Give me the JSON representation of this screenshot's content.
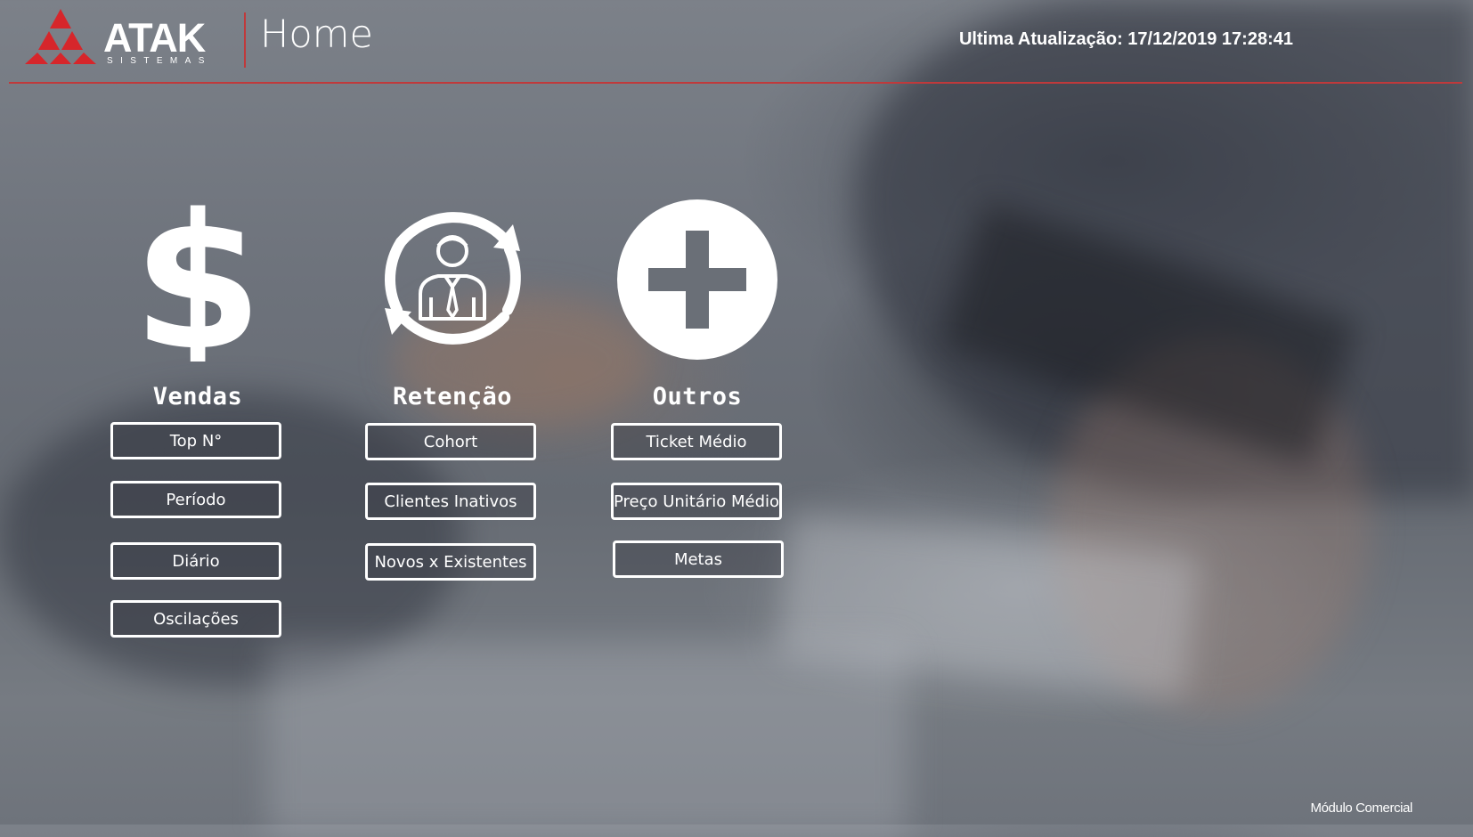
{
  "header": {
    "logo_text": "ATAK",
    "logo_subtext": "SISTEMAS",
    "page_title": "Home",
    "last_update": "Ultima Atualização: 17/12/2019 17:28:41"
  },
  "colors": {
    "accent": "#c0393b",
    "text": "#ffffff"
  },
  "sections": [
    {
      "title": "Vendas",
      "icon": "dollar-icon",
      "buttons": [
        "Top N°",
        "Período",
        "Diário",
        "Oscilações"
      ]
    },
    {
      "title": "Retenção",
      "icon": "customer-retention-icon",
      "buttons": [
        "Cohort",
        "Clientes Inativos",
        "Novos x Existentes"
      ]
    },
    {
      "title": "Outros",
      "icon": "plus-circle-icon",
      "buttons": [
        "Ticket Médio",
        "Preço Unitário Médio",
        "Metas"
      ]
    }
  ],
  "footer": {
    "module_label": "Módulo Comercial"
  }
}
